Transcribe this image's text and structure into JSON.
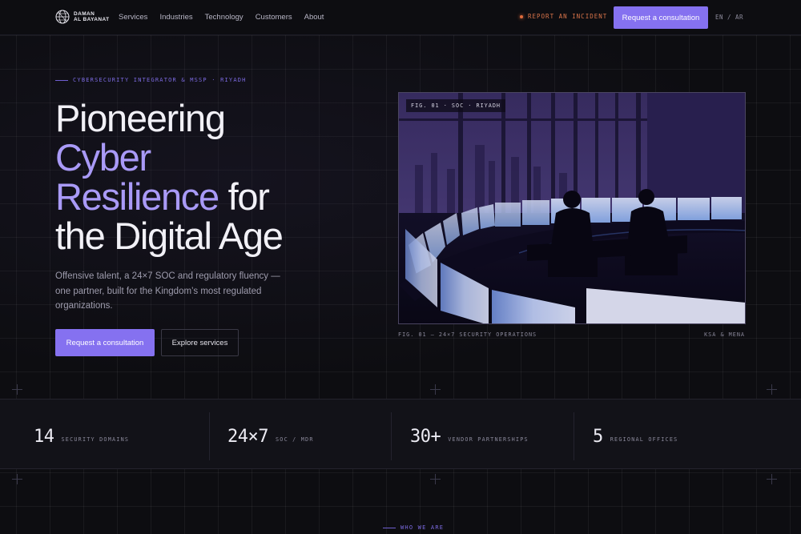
{
  "brand": {
    "name_line1": "DAMAN",
    "name_line2": "AL BAYANAT",
    "logo_icon": "globe-mesh-icon"
  },
  "nav": {
    "links": [
      "Services",
      "Industries",
      "Technology",
      "Customers",
      "About"
    ],
    "incident_label": "REPORT AN INCIDENT",
    "cta_label": "Request a consultation",
    "lang_en": "EN",
    "lang_sep": "/",
    "lang_ar": "AR"
  },
  "hero": {
    "eyebrow": "CYBERSECURITY INTEGRATOR & MSSP · RIYADH",
    "headline_line1": "Pioneering",
    "headline_accent1": "Cyber",
    "headline_accent2": "Resilience",
    "headline_for": "for",
    "headline_line4": "the Digital Age",
    "subtext": "Offensive talent, a 24×7 SOC and regulatory fluency — one partner, built for the Kingdom’s most regulated organizations.",
    "primary_cta": "Request a consultation",
    "secondary_cta": "Explore services"
  },
  "figure": {
    "tag": "FIG. 01 · SOC · RIYADH",
    "caption": "FIG. 01 — 24×7 SECURITY OPERATIONS",
    "region": "KSA & MENA"
  },
  "stats": [
    {
      "value": "14",
      "label": "SECURITY DOMAINS"
    },
    {
      "value": "24×7",
      "label": "SOC / MDR"
    },
    {
      "value": "30+",
      "label": "VENDOR PARTNERSHIPS"
    },
    {
      "value": "5",
      "label": "REGIONAL OFFICES"
    }
  ],
  "next_section": {
    "eyebrow": "WHO WE ARE"
  },
  "colors": {
    "accent": "#8571f0",
    "accent_text": "#a99af7",
    "incident": "#d9744a",
    "background": "#0d0d11"
  }
}
